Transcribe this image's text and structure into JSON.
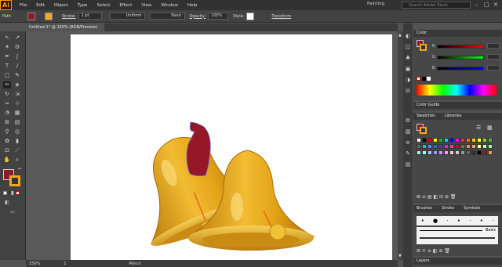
{
  "app": {
    "logo": "Ai"
  },
  "menu": [
    "File",
    "Edit",
    "Object",
    "Type",
    "Select",
    "Effect",
    "View",
    "Window",
    "Help"
  ],
  "workspace": "Painting",
  "search_placeholder": "Search Adobe Stock",
  "control": {
    "selection": "Path",
    "stroke_label": "Stroke:",
    "stroke_weight": "1 pt",
    "stroke_profile": "Uniform",
    "brush": "Basic",
    "opacity_label": "Opacity:",
    "opacity": "100%",
    "style_label": "Style:",
    "transform": "Transform",
    "fill_color": "#8e1b2a",
    "stroke_color": "#f2a81e"
  },
  "document": {
    "tab": "Untitled-1* @ 150% (RGB/Preview)"
  },
  "status": {
    "zoom": "150%",
    "page": "1",
    "tool": "Pencil"
  },
  "panels": {
    "color": {
      "title": "Color",
      "r": "R",
      "g": "G",
      "b": "B"
    },
    "color_guide": {
      "title": "Color Guide"
    },
    "swatches": {
      "tab1": "Swatches",
      "tab2": "Libraries"
    },
    "brushes": {
      "tab1": "Brushes",
      "tab2": "Stroke",
      "tab3": "Symbols",
      "basic_label": "Basic"
    },
    "layers": {
      "title": "Layers"
    }
  },
  "colors": {
    "bell": "#e3a116",
    "bell_dark": "#b97a0a",
    "bell_light": "#f6cf55",
    "hat": "#961827",
    "artboard": "#ffffff"
  }
}
